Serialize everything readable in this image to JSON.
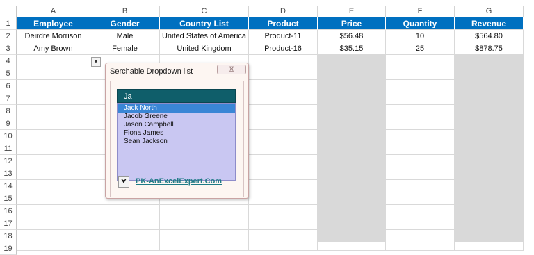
{
  "columns": [
    "A",
    "B",
    "C",
    "D",
    "E",
    "F",
    "G"
  ],
  "rows": [
    "1",
    "2",
    "3",
    "4",
    "5",
    "6",
    "7",
    "8",
    "9",
    "10",
    "11",
    "12",
    "13",
    "14",
    "15",
    "16",
    "17",
    "18",
    "19"
  ],
  "table": {
    "headers": [
      "Employee",
      "Gender",
      "Country List",
      "Product",
      "Price",
      "Quantity",
      "Revenue"
    ],
    "data": [
      [
        "Deirdre Morrison",
        "Male",
        "United States of America",
        "Product-11",
        "$56.48",
        "10",
        "$564.80"
      ],
      [
        "Amy Brown",
        "Female",
        "United Kingdom",
        "Product-16",
        "$35.15",
        "25",
        "$878.75"
      ]
    ]
  },
  "colors": {
    "header_fill": "#0070c0",
    "calc_column_fill": "#d9d9d9",
    "search_box": "#0f5e6a",
    "list_fill": "#c9c7f2",
    "selected_item": "#3a86d6"
  },
  "cell_dropdown": {
    "icon": "dropdown-arrow-icon",
    "glyph": "▼"
  },
  "form": {
    "title": "Serchable Dropdown list",
    "close_glyph": "☒",
    "search_value": "Ja",
    "items": [
      "Jack North",
      "Jacob Greene",
      "Jason Campbell",
      "Fiona James",
      "Sean Jackson"
    ],
    "selected_index": 0,
    "icon_button_glyph": "⮟",
    "link_text": "PK-AnExcelExpert.Com"
  }
}
